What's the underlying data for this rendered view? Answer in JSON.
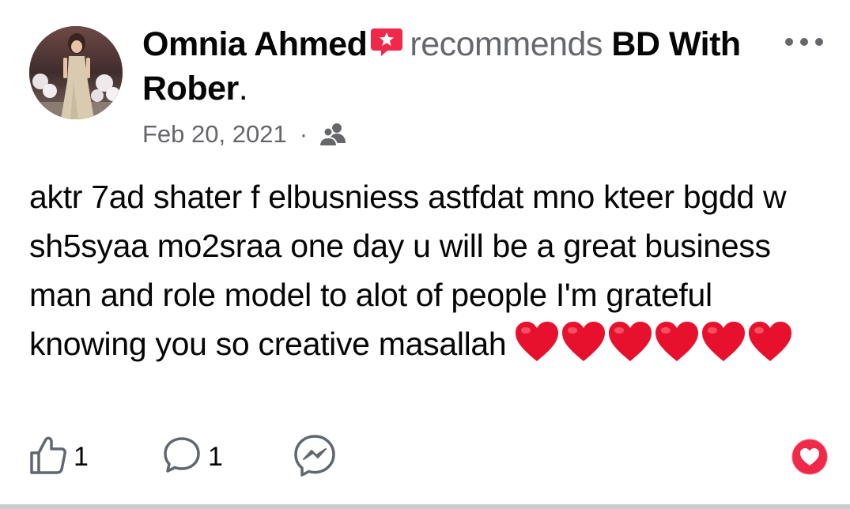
{
  "post": {
    "author_name": "Omnia Ahmed",
    "action_text": "recommends",
    "page_name": "BD With Rober",
    "trailing_punct": ".",
    "date": "Feb 20, 2021",
    "meta_separator": "·",
    "audience_icon": "friends-icon",
    "body": "aktr 7ad shater f elbusniess astfdat mno kteer bgdd w sh5syaa mo2sraa one day u will be a great business man and role model to alot of people I'm grateful knowing you so creative masallah",
    "hearts_count": 6
  },
  "actions": {
    "like_count": "1",
    "comment_count": "1"
  },
  "icons": {
    "recommend_badge": "recommendation-badge-icon",
    "more": "more-options-icon",
    "like": "thumbs-up-icon",
    "comment": "comment-bubble-icon",
    "share": "messenger-icon",
    "love": "love-reaction-icon"
  },
  "colors": {
    "accent_red": "#f02849",
    "secondary_text": "#65676b",
    "primary_text": "#050505",
    "heart_red": "#e8112d"
  }
}
